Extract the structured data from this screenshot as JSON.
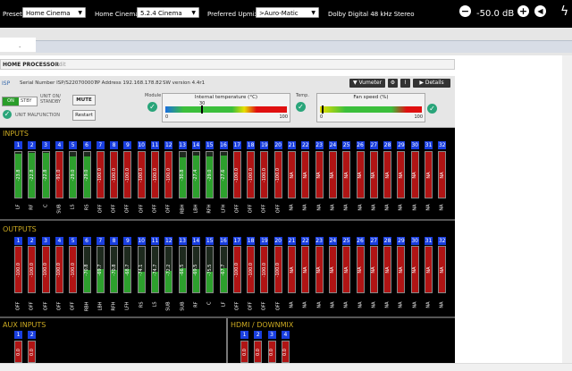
{
  "top": {
    "preset_label": "Preset :",
    "preset_value": "Home Cinema",
    "home_cinema_label": "Home Cinema :",
    "home_cinema_value": "5.2.4 Cinema",
    "upmix_label": "Preferred Upmix :",
    "upmix_value": ">Auro-Matic",
    "format": "Dolby Digital 48 kHz Stereo",
    "volume": "-50.0 dB",
    "icons": [
      "minus-icon",
      "plus-icon",
      "speaker-icon",
      "bolt-icon"
    ]
  },
  "tab": {
    "label": "."
  },
  "processor": {
    "title": "HOME PROCESSOR",
    "edit": "Edit",
    "isp": "ISP",
    "serial": "Serial Number ISP/S220700007",
    "ip": "IP Address 192.168.178.82",
    "sw": "SW version 4.4r1",
    "on": "ON",
    "stby": "STBY",
    "unit_on": "UNIT ON/ STANDBY",
    "mute": "MUTE",
    "malfunction": "UNIT MALFUNCTION",
    "restart": "Restart",
    "module": "Module",
    "temp_title": "Internal temperature (°C)",
    "temp_value": "30",
    "temp_min": "0",
    "temp_max": "100",
    "temp_label": "Temp.",
    "fan_title": "Fan speed (%)",
    "fan_min": "0",
    "fan_max": "100",
    "vumeter": "Vumeter",
    "details": "Details"
  },
  "inputs": {
    "title": "INPUTS",
    "channels": [
      {
        "n": "1",
        "v": "-23.8",
        "l": "LF",
        "g": true
      },
      {
        "n": "2",
        "v": "-22.8",
        "l": "RF",
        "g": true
      },
      {
        "n": "3",
        "v": "-22.8",
        "l": "C",
        "g": true
      },
      {
        "n": "4",
        "v": "-91.0",
        "l": "SUB",
        "g": false
      },
      {
        "n": "5",
        "v": "-29.0",
        "l": "LS",
        "g": true
      },
      {
        "n": "6",
        "v": "-29.0",
        "l": "RS",
        "g": true
      },
      {
        "n": "7",
        "v": "-100.0",
        "l": "OFF",
        "g": false
      },
      {
        "n": "8",
        "v": "-100.0",
        "l": "OFF",
        "g": false
      },
      {
        "n": "9",
        "v": "-100.0",
        "l": "OFF",
        "g": false
      },
      {
        "n": "10",
        "v": "-100.0",
        "l": "OFF",
        "g": false
      },
      {
        "n": "11",
        "v": "-100.0",
        "l": "OFF",
        "g": false
      },
      {
        "n": "12",
        "v": "-100.0",
        "l": "OFF",
        "g": false
      },
      {
        "n": "13",
        "v": "-30.8",
        "l": "RBH",
        "g": true
      },
      {
        "n": "14",
        "v": "-27.4",
        "l": "LBH",
        "g": true
      },
      {
        "n": "15",
        "v": "-29.0",
        "l": "RFH",
        "g": true
      },
      {
        "n": "16",
        "v": "-27.6",
        "l": "LFH",
        "g": true
      },
      {
        "n": "17",
        "v": "-100.0",
        "l": "OFF",
        "g": false
      },
      {
        "n": "18",
        "v": "-100.0",
        "l": "OFF",
        "g": false
      },
      {
        "n": "19",
        "v": "-100.0",
        "l": "OFF",
        "g": false
      },
      {
        "n": "20",
        "v": "-100.0",
        "l": "OFF",
        "g": false
      },
      {
        "n": "21",
        "v": "NA",
        "l": "NA",
        "g": false
      },
      {
        "n": "22",
        "v": "NA",
        "l": "NA",
        "g": false
      },
      {
        "n": "23",
        "v": "NA",
        "l": "NA",
        "g": false
      },
      {
        "n": "24",
        "v": "NA",
        "l": "NA",
        "g": false
      },
      {
        "n": "25",
        "v": "NA",
        "l": "NA",
        "g": false
      },
      {
        "n": "26",
        "v": "NA",
        "l": "NA",
        "g": false
      },
      {
        "n": "27",
        "v": "NA",
        "l": "NA",
        "g": false
      },
      {
        "n": "28",
        "v": "NA",
        "l": "NA",
        "g": false
      },
      {
        "n": "29",
        "v": "NA",
        "l": "NA",
        "g": false
      },
      {
        "n": "30",
        "v": "NA",
        "l": "NA",
        "g": false
      },
      {
        "n": "31",
        "v": "NA",
        "l": "NA",
        "g": false
      },
      {
        "n": "32",
        "v": "NA",
        "l": "NA",
        "g": false
      }
    ]
  },
  "outputs": {
    "title": "OUTPUTS",
    "channels": [
      {
        "n": "1",
        "v": "-100.0",
        "l": "OFF",
        "g": false
      },
      {
        "n": "2",
        "v": "-100.0",
        "l": "OFF",
        "g": false
      },
      {
        "n": "3",
        "v": "-100.0",
        "l": "OFF",
        "g": false
      },
      {
        "n": "4",
        "v": "-100.0",
        "l": "OFF",
        "g": false
      },
      {
        "n": "5",
        "v": "-100.0",
        "l": "OFF",
        "g": false
      },
      {
        "n": "6",
        "v": "-70.8",
        "l": "RBH",
        "g": true
      },
      {
        "n": "7",
        "v": "-69.7",
        "l": "LBH",
        "g": true
      },
      {
        "n": "8",
        "v": "-70.8",
        "l": "RFH",
        "g": true
      },
      {
        "n": "9",
        "v": "-68.7",
        "l": "LFH",
        "g": true
      },
      {
        "n": "10",
        "v": "-74.1",
        "l": "RS",
        "g": true
      },
      {
        "n": "11",
        "v": "-74.7",
        "l": "LS",
        "g": true
      },
      {
        "n": "12",
        "v": "-72.2",
        "l": "SUB",
        "g": true
      },
      {
        "n": "13",
        "v": "-66.5",
        "l": "SUB",
        "g": true
      },
      {
        "n": "14",
        "v": "-69.5",
        "l": "RF",
        "g": true
      },
      {
        "n": "15",
        "v": "-75.5",
        "l": "C",
        "g": true
      },
      {
        "n": "16",
        "v": "-67.7",
        "l": "LF",
        "g": true
      },
      {
        "n": "17",
        "v": "-100.0",
        "l": "OFF",
        "g": false
      },
      {
        "n": "18",
        "v": "-100.0",
        "l": "OFF",
        "g": false
      },
      {
        "n": "19",
        "v": "-100.0",
        "l": "OFF",
        "g": false
      },
      {
        "n": "20",
        "v": "-100.0",
        "l": "OFF",
        "g": false
      },
      {
        "n": "21",
        "v": "NA",
        "l": "NA",
        "g": false
      },
      {
        "n": "22",
        "v": "NA",
        "l": "NA",
        "g": false
      },
      {
        "n": "23",
        "v": "NA",
        "l": "NA",
        "g": false
      },
      {
        "n": "24",
        "v": "NA",
        "l": "NA",
        "g": false
      },
      {
        "n": "25",
        "v": "NA",
        "l": "NA",
        "g": false
      },
      {
        "n": "26",
        "v": "NA",
        "l": "NA",
        "g": false
      },
      {
        "n": "27",
        "v": "NA",
        "l": "NA",
        "g": false
      },
      {
        "n": "28",
        "v": "NA",
        "l": "NA",
        "g": false
      },
      {
        "n": "29",
        "v": "NA",
        "l": "NA",
        "g": false
      },
      {
        "n": "30",
        "v": "NA",
        "l": "NA",
        "g": false
      },
      {
        "n": "31",
        "v": "NA",
        "l": "NA",
        "g": false
      },
      {
        "n": "32",
        "v": "NA",
        "l": "NA",
        "g": false
      }
    ]
  },
  "aux": {
    "title": "AUX INPUTS",
    "channels": [
      {
        "n": "1",
        "v": "0.0"
      },
      {
        "n": "2",
        "v": "0.0"
      }
    ]
  },
  "hdmi": {
    "title": "HDMI / DOWNMIX",
    "channels": [
      {
        "n": "1",
        "v": "0.0"
      },
      {
        "n": "2",
        "v": "0.0"
      },
      {
        "n": "3",
        "v": "0.0"
      },
      {
        "n": "4",
        "v": "0.0"
      }
    ]
  },
  "colors": {
    "accent": "#1a3fe0",
    "ok": "#2aa57a",
    "red": "#b01414",
    "green": "#2da02d"
  }
}
